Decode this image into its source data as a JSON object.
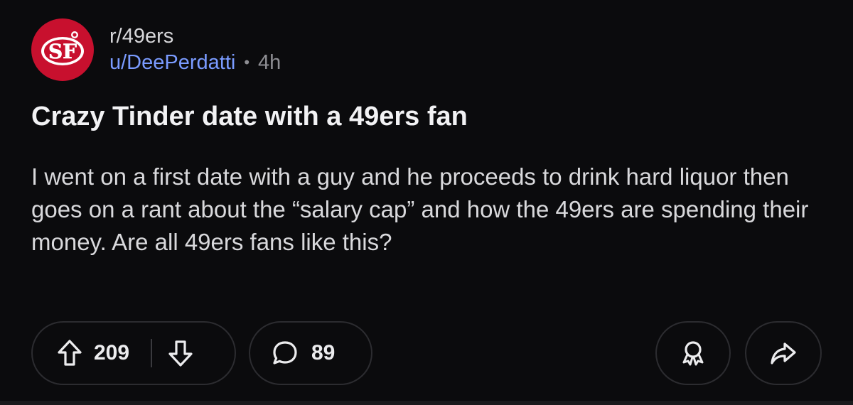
{
  "post": {
    "subreddit": "r/49ers",
    "username": "u/DeePerdatti",
    "separator": "•",
    "time_ago": "4h",
    "title": "Crazy Tinder date with a 49ers fan",
    "body": "I went on a first date with a guy and he proceeds to drink hard liquor then goes on a rant about the “salary cap” and how the 49ers are spending their money. Are all 49ers fans like this?"
  },
  "actions": {
    "upvotes": "209",
    "comments": "89"
  },
  "icons": {
    "avatar": "49ers-logo-icon",
    "upvote": "arrow-up-icon",
    "downvote": "arrow-down-icon",
    "comment": "comment-bubble-icon",
    "award": "award-ribbon-icon",
    "share": "share-arrow-icon"
  },
  "colors": {
    "background": "#0b0b0d",
    "username": "#7a9bff",
    "avatar_red": "#c8102e"
  }
}
